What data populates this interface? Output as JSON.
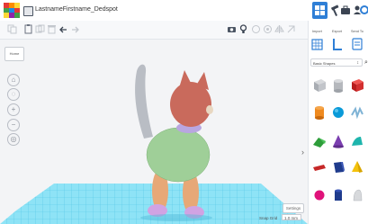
{
  "app": {
    "document_title": "LastnameFirstname_Dedspot"
  },
  "header": {
    "grid_view_icon": "grid-view-icon",
    "hammer_icon": "hammer-icon",
    "suitcase_icon": "suitcase-icon",
    "user_icon": "user-icon"
  },
  "viewport": {
    "home_label": "Home",
    "settings_label": "Settings",
    "snap_grid_label": "Snap Grid",
    "snap_grid_value": "1.0 mm"
  },
  "panel": {
    "tabs": [
      {
        "label": "Import"
      },
      {
        "label": "Export"
      },
      {
        "label": "Send To"
      }
    ],
    "shapes_category": "Basic Shapes"
  },
  "colors": {
    "accent": "#2f7fd6",
    "grid": "#6ed6f0"
  }
}
